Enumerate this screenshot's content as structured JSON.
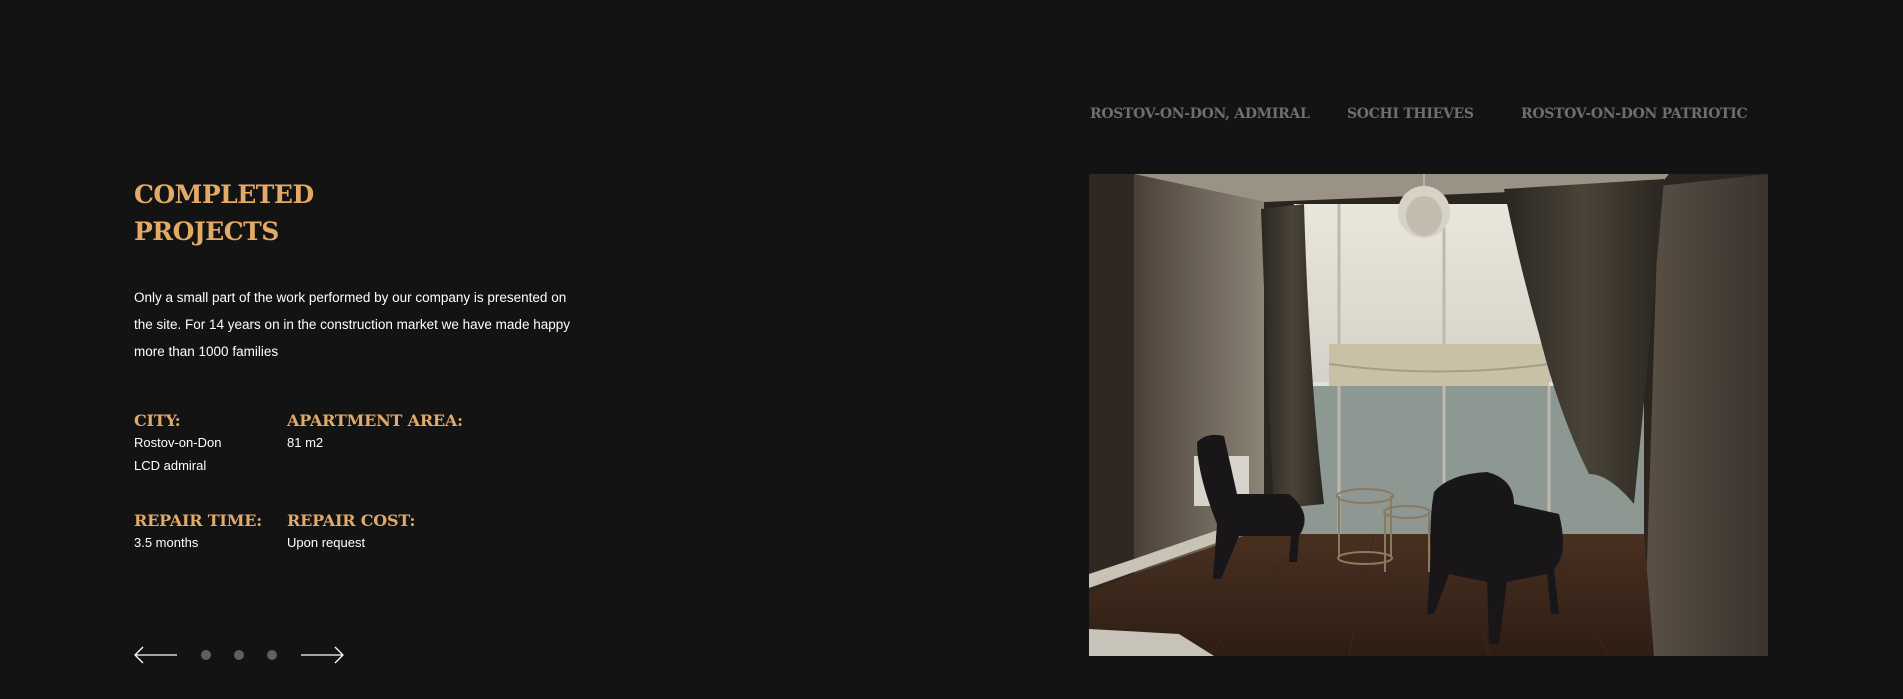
{
  "section": {
    "title_lines": [
      "COMPLETED",
      "PROJECTS"
    ],
    "description": "Only a small part of the work performed by our company is presented on the site. For 14 years on in the construction market we have made happy more than 1000 families"
  },
  "specs": {
    "city": {
      "label": "CITY:",
      "values": [
        "Rostov-on-Don",
        "LCD admiral"
      ]
    },
    "area": {
      "label": "APARTMENT AREA:",
      "value": "81 m2"
    },
    "time": {
      "label": "REPAIR TIME:",
      "value": "3.5 months"
    },
    "cost": {
      "label": "REPAIR COST:",
      "value": "Upon request"
    }
  },
  "slider": {
    "prev_icon": "arrow-left-icon",
    "next_icon": "arrow-right-icon",
    "dots_count": 3
  },
  "project_tabs": [
    {
      "label": "ROSTOV-ON-DON, ADMIRAL"
    },
    {
      "label": "SOCHI THIEVES"
    },
    {
      "label": "ROSTOV-ON-DON PATRIOTIC"
    }
  ],
  "photo": {
    "subject": "apartment-interior-photo"
  },
  "colors": {
    "background": "#131313",
    "accent": "#e2a967",
    "text": "#ffffff",
    "muted": "#6e6e6e",
    "dot": "#5f5f5f"
  }
}
